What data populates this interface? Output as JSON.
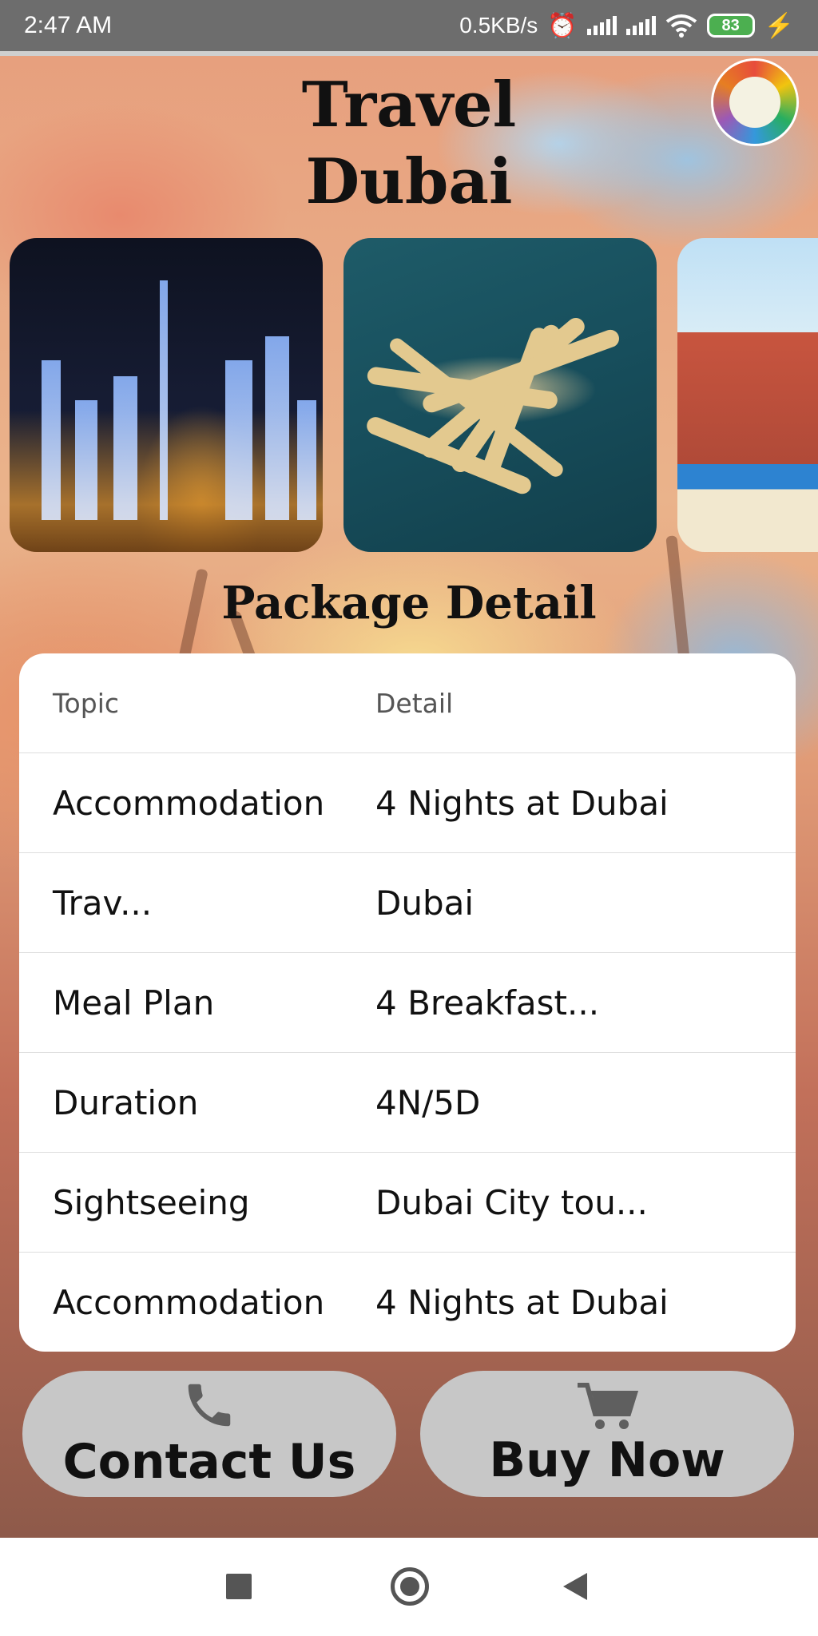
{
  "status_bar": {
    "time": "2:47 AM",
    "network_speed": "0.5KB/s",
    "battery": "83",
    "icons": [
      "alarm-icon",
      "signal-icon",
      "signal-icon",
      "wifi-icon",
      "battery-icon",
      "charging-icon"
    ]
  },
  "header": {
    "title_line1": "Travel",
    "title_line2": "Dubai"
  },
  "carousel": {
    "images": [
      "dubai-skyline-night",
      "palm-jumeirah-aerial",
      "atlantis-hotel"
    ]
  },
  "package": {
    "heading": "Package Detail",
    "columns": {
      "topic": "Topic",
      "detail": "Detail"
    },
    "rows": [
      {
        "topic": "Accommodation",
        "detail": "4 Nights at Dubai"
      },
      {
        "topic": "Trav...",
        "detail": "Dubai"
      },
      {
        "topic": "Meal Plan",
        "detail": "4 Breakfast..."
      },
      {
        "topic": "Duration",
        "detail": "4N/5D"
      },
      {
        "topic": "Sightseeing",
        "detail": "Dubai City tou..."
      },
      {
        "topic": "Accommodation",
        "detail": "4 Nights at Dubai"
      }
    ]
  },
  "actions": {
    "contact_label": "Contact Us",
    "contact_icon": "phone-icon",
    "buy_label": "Buy Now",
    "buy_icon": "cart-icon"
  },
  "colors": {
    "status_bar": "#6d6d6d",
    "button_bg": "#c7c7c7",
    "battery": "#4caf50"
  }
}
